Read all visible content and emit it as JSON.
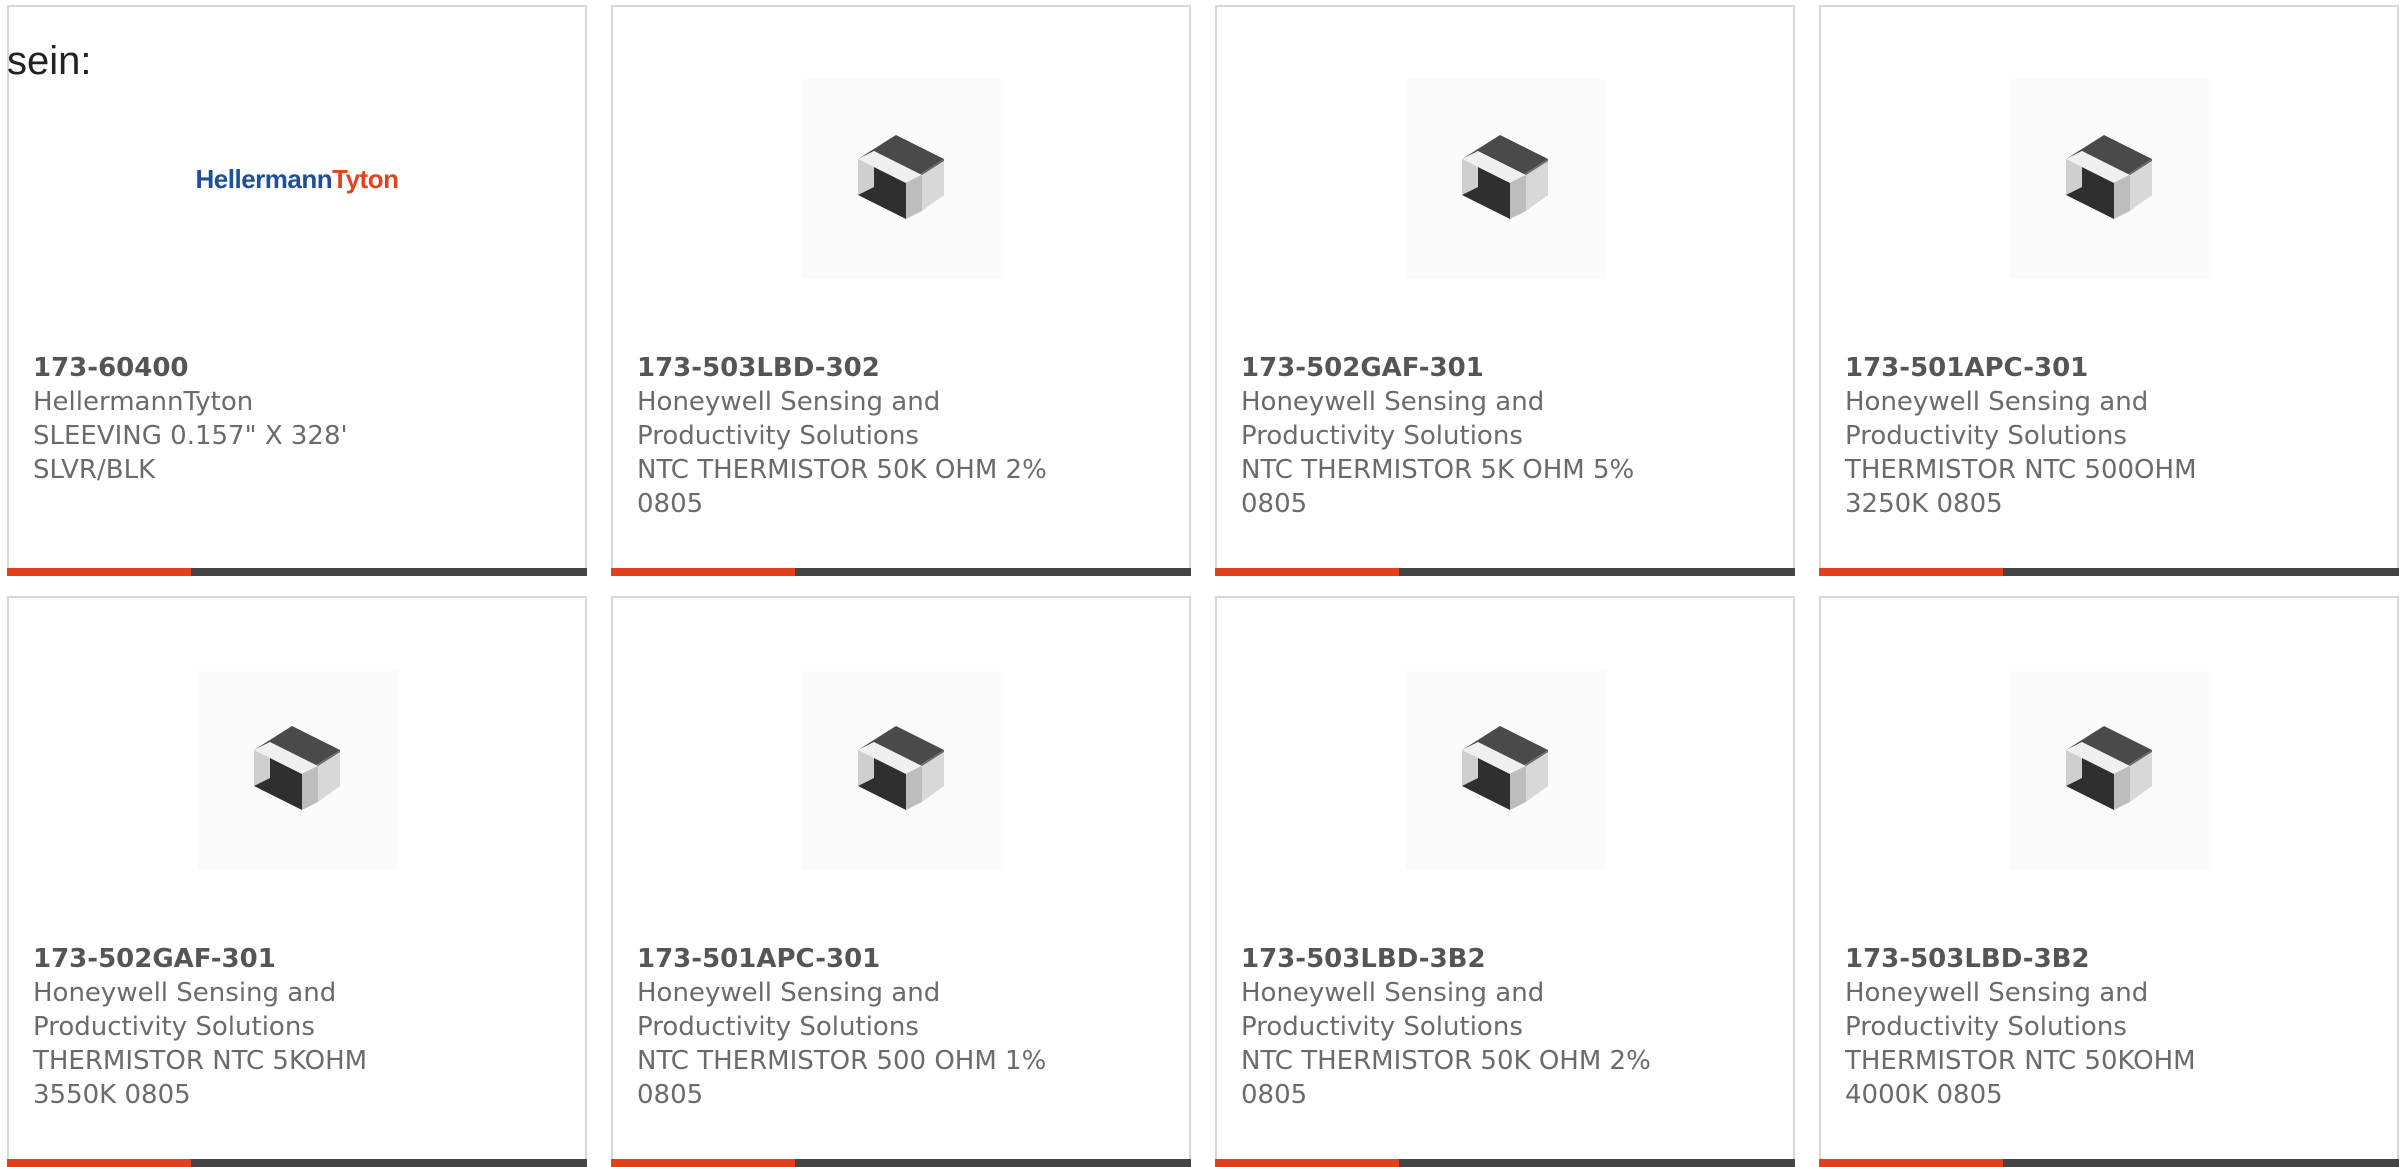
{
  "intro_text": "sein:",
  "colors": {
    "accent": "#e2401a",
    "bar": "#444444",
    "card_border": "#d8d8d8",
    "text": "#6b6b6b"
  },
  "logo": {
    "part_a": "Hellermann",
    "part_b": "Tyton"
  },
  "products": [
    {
      "part_number": "173-60400",
      "manufacturer": "HellermannTyton",
      "description": "SLEEVING 0.157\" X 328' SLVR/BLK",
      "image": "hellermanntyton-logo"
    },
    {
      "part_number": "173-503LBD-302",
      "manufacturer": "Honeywell Sensing and Productivity Solutions",
      "description": "NTC THERMISTOR 50K OHM 2% 0805",
      "image": "smd-chip-thermistor"
    },
    {
      "part_number": "173-502GAF-301",
      "manufacturer": "Honeywell Sensing and Productivity Solutions",
      "description": "NTC THERMISTOR 5K OHM 5% 0805",
      "image": "smd-chip-thermistor"
    },
    {
      "part_number": "173-501APC-301",
      "manufacturer": "Honeywell Sensing and Productivity Solutions",
      "description": "THERMISTOR NTC 500OHM 3250K 0805",
      "image": "smd-chip-thermistor"
    },
    {
      "part_number": "173-502GAF-301",
      "manufacturer": "Honeywell Sensing and Productivity Solutions",
      "description": "THERMISTOR NTC 5KOHM 3550K 0805",
      "image": "smd-chip-thermistor"
    },
    {
      "part_number": "173-501APC-301",
      "manufacturer": "Honeywell Sensing and Productivity Solutions",
      "description": "NTC THERMISTOR 500 OHM 1% 0805",
      "image": "smd-chip-thermistor"
    },
    {
      "part_number": "173-503LBD-3B2",
      "manufacturer": "Honeywell Sensing and Productivity Solutions",
      "description": "NTC THERMISTOR 50K OHM 2% 0805",
      "image": "smd-chip-thermistor"
    },
    {
      "part_number": "173-503LBD-3B2",
      "manufacturer": "Honeywell Sensing and Productivity Solutions",
      "description": "THERMISTOR NTC 50KOHM 4000K 0805",
      "image": "smd-chip-thermistor"
    }
  ]
}
